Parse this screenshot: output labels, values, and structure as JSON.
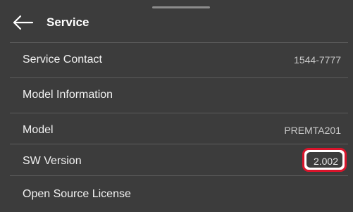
{
  "header": {
    "title": "Service",
    "back_icon": "arrow-left-icon"
  },
  "rows": [
    {
      "label": "Service Contact",
      "value": "1544-7777"
    },
    {
      "label": "Model Information",
      "value": ""
    },
    {
      "label": "Model",
      "value": "PREMTA201"
    },
    {
      "label": "SW Version",
      "value": "2.002"
    },
    {
      "label": "Open Source License",
      "value": ""
    }
  ],
  "colors": {
    "background": "#3c3c3c",
    "text": "#f2f2f2",
    "value_text": "#c9c9c9",
    "divider": "#5c5c5c",
    "highlight": "#d9142b"
  }
}
